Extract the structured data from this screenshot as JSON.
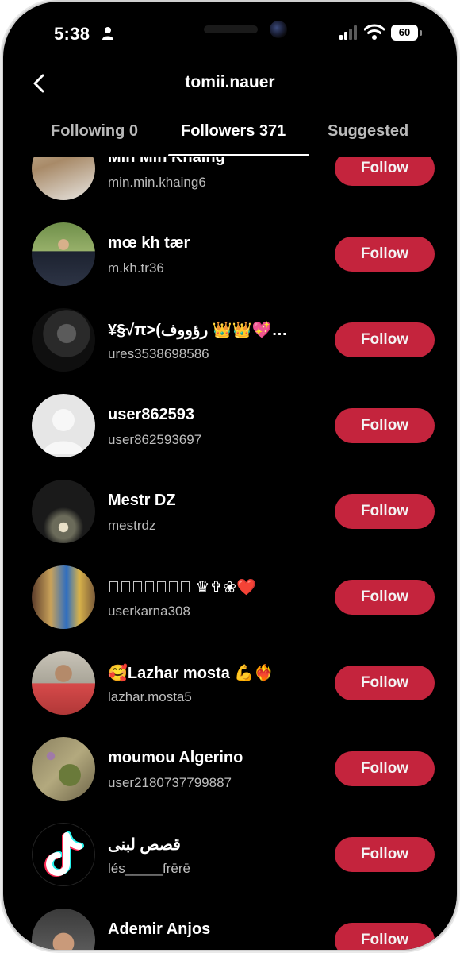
{
  "status_bar": {
    "time": "5:38",
    "battery": "60"
  },
  "header": {
    "title": "tomii.nauer"
  },
  "tabs": [
    {
      "label": "Following 0"
    },
    {
      "label": "Followers 371"
    },
    {
      "label": "Suggested"
    }
  ],
  "rows": [
    {
      "name": "Min Min Khaing",
      "handle": "min.min.khaing6",
      "button": "Follow"
    },
    {
      "name": "mœ kh tær",
      "handle": "m.kh.tr36",
      "button": "Follow"
    },
    {
      "name": "¥§√π>(رؤووف 👑👑💖…",
      "handle": "ures3538698586",
      "button": "Follow"
    },
    {
      "name": "user862593",
      "handle": "user862593697",
      "button": "Follow"
    },
    {
      "name": "Mestr DZ",
      "handle": "mestrdz",
      "button": "Follow"
    },
    {
      "name": "♛ꦿ𝑲𝒂𝒓𝒏𝒂 ♛✞❀❤️",
      "handle": "userkarna308",
      "button": "Follow"
    },
    {
      "name": "🥰Lazhar mosta 💪❤️‍🔥",
      "handle": "lazhar.mosta5",
      "button": "Follow"
    },
    {
      "name": "moumou Algerino",
      "handle": "user2180737799887",
      "button": "Follow"
    },
    {
      "name": "قصص لبنى",
      "handle": "lés_____frērē",
      "button": "Follow"
    },
    {
      "name": "Ademir Anjos",
      "handle": "",
      "button": "Follow"
    }
  ]
}
